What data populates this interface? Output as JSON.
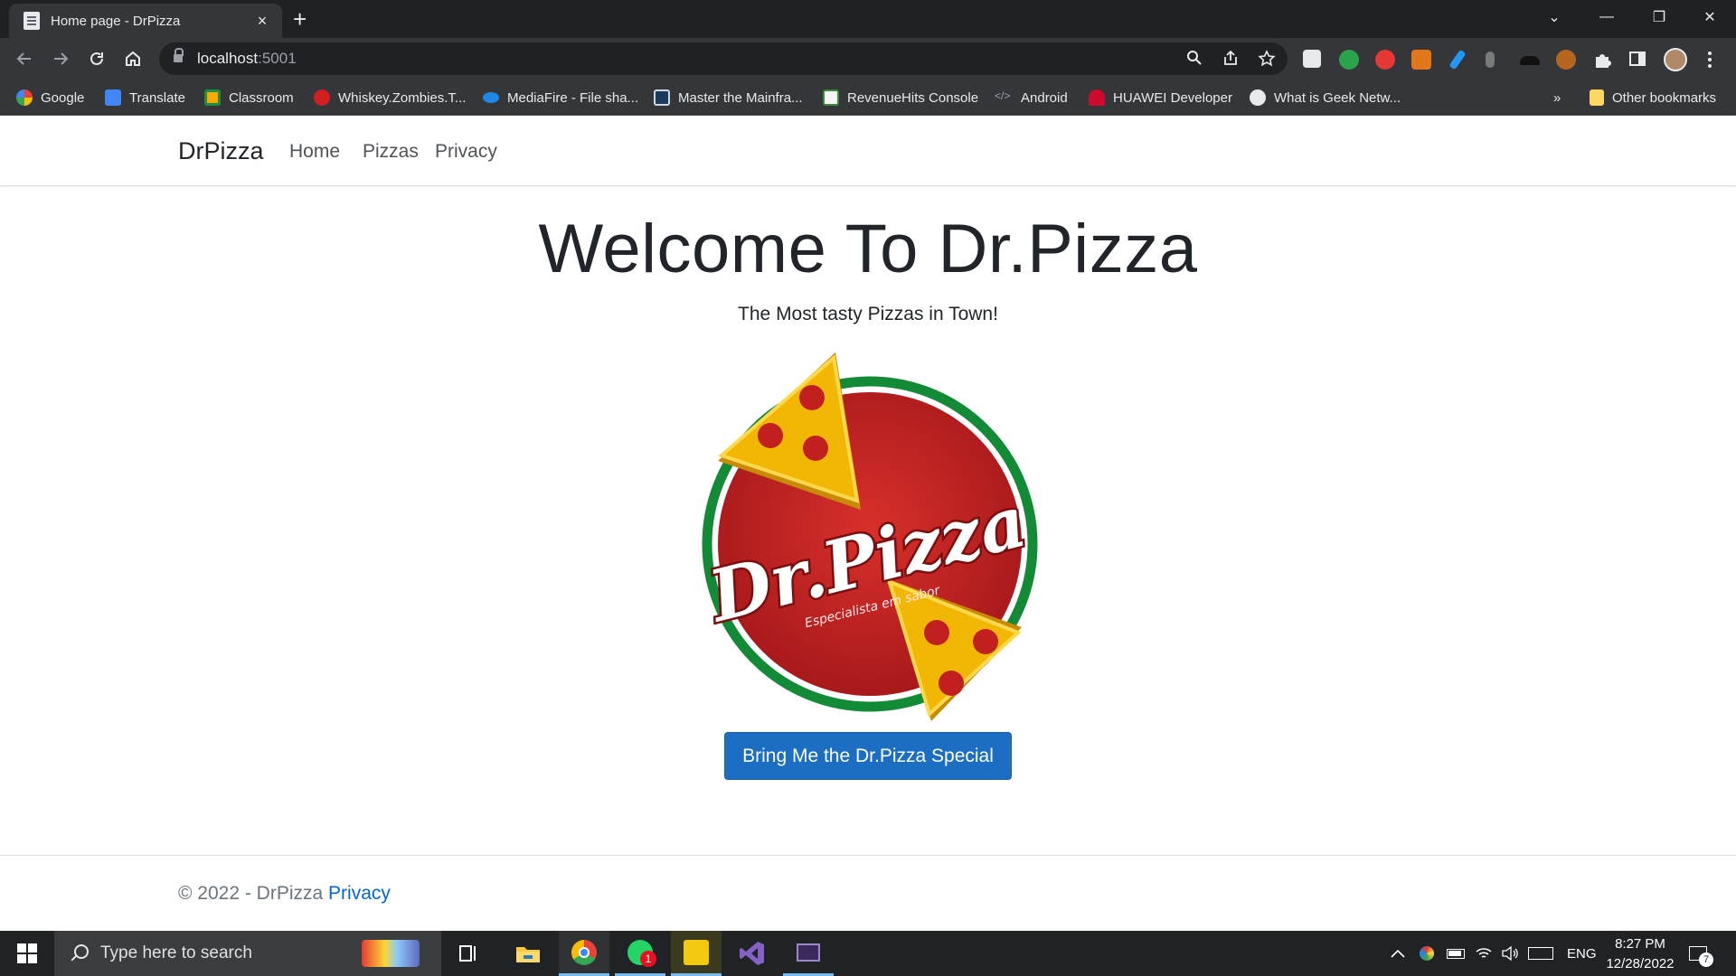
{
  "browser": {
    "tab_title": "Home page - DrPizza",
    "tab_close": "×",
    "new_tab": "+",
    "url_host": "localhost",
    "url_port": ":5001",
    "window_controls": {
      "tab_search": "⌄",
      "minimize": "—",
      "restore": "❐",
      "close": "✕"
    },
    "bookmarks": [
      {
        "label": "Google",
        "icon": "google-icon",
        "color": "#4285f4"
      },
      {
        "label": "Translate",
        "icon": "translate-icon",
        "color": "#4285f4"
      },
      {
        "label": "Classroom",
        "icon": "classroom-icon",
        "color": "#f9ab00"
      },
      {
        "label": "Whiskey.Zombies.T...",
        "icon": "zombies-icon",
        "color": "#d21e1e"
      },
      {
        "label": "MediaFire - File sha...",
        "icon": "mediafire-icon",
        "color": "#1f88e5"
      },
      {
        "label": "Master the Mainfra...",
        "icon": "mainframe-icon",
        "color": "#1b3a5c"
      },
      {
        "label": "RevenueHits Console",
        "icon": "revenuehits-icon",
        "color": "#e8e8e8"
      },
      {
        "label": "Android",
        "icon": "code-icon",
        "color": "#9aa0a6"
      },
      {
        "label": "HUAWEI Developer",
        "icon": "huawei-icon",
        "color": "#cf0a2c"
      },
      {
        "label": "What is Geek Netw...",
        "icon": "globe-icon",
        "color": "#e8eaed"
      }
    ],
    "more_bookmarks": "»",
    "other_bookmarks": "Other bookmarks"
  },
  "site": {
    "brand": "DrPizza",
    "nav": [
      "Home",
      "Pizzas",
      "Privacy"
    ],
    "hero_title": "Welcome To Dr.Pizza",
    "hero_subtitle": "The Most tasty Pizzas in Town!",
    "logo_text": "Dr.Pizza",
    "logo_tagline": "Especialista em sabor",
    "cta_label": "Bring Me the Dr.Pizza Special",
    "footer_prefix": "© 2022 - DrPizza",
    "footer_link": "Privacy",
    "colors": {
      "primary": "#1b6ec2",
      "link": "#0366d6",
      "pizza_red": "#c1201f",
      "crust_green": "#138a36",
      "cheese": "#f2b705"
    }
  },
  "taskbar": {
    "search_placeholder": "Type here to search",
    "whatsapp_badge": "1",
    "language": "ENG",
    "time": "8:27 PM",
    "date": "12/28/2022",
    "notification_count": "7"
  }
}
